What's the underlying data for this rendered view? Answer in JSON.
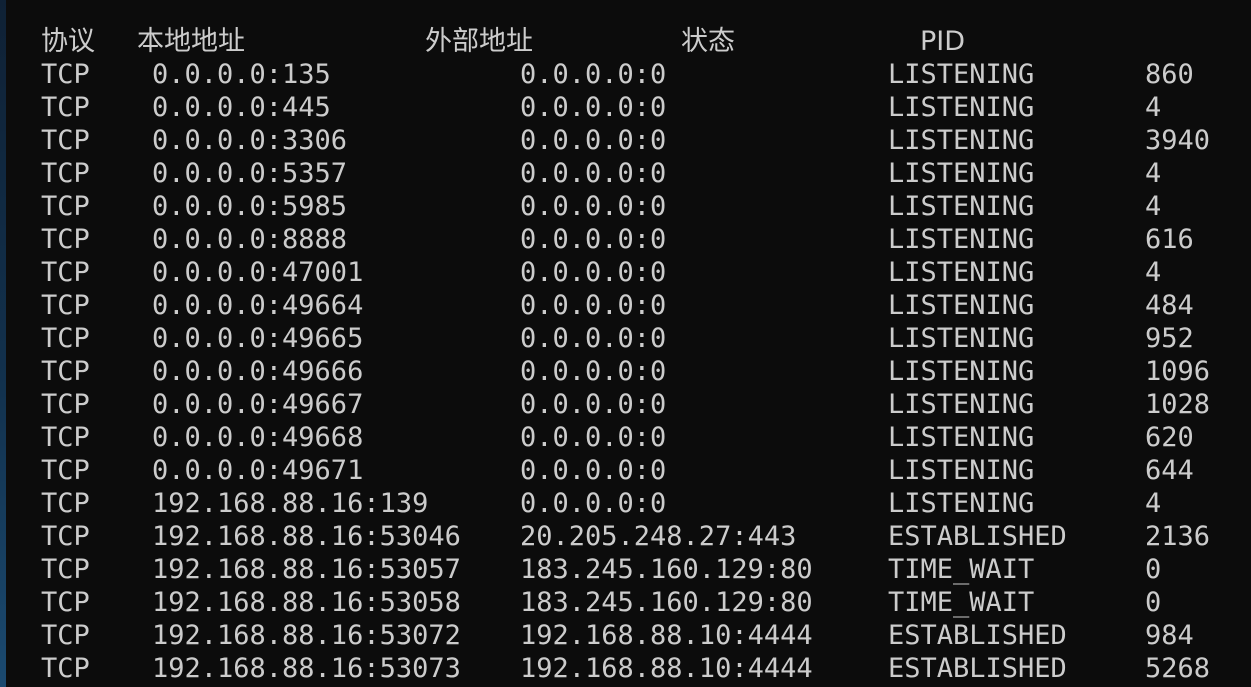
{
  "header": {
    "proto": "协议",
    "local": "本地地址",
    "foreign": "外部地址",
    "state": "状态",
    "pid": "PID"
  },
  "rows": [
    {
      "proto": "TCP",
      "local": "0.0.0.0:135",
      "foreign": "0.0.0.0:0",
      "state": "LISTENING",
      "pid": "860"
    },
    {
      "proto": "TCP",
      "local": "0.0.0.0:445",
      "foreign": "0.0.0.0:0",
      "state": "LISTENING",
      "pid": "4"
    },
    {
      "proto": "TCP",
      "local": "0.0.0.0:3306",
      "foreign": "0.0.0.0:0",
      "state": "LISTENING",
      "pid": "3940"
    },
    {
      "proto": "TCP",
      "local": "0.0.0.0:5357",
      "foreign": "0.0.0.0:0",
      "state": "LISTENING",
      "pid": "4"
    },
    {
      "proto": "TCP",
      "local": "0.0.0.0:5985",
      "foreign": "0.0.0.0:0",
      "state": "LISTENING",
      "pid": "4"
    },
    {
      "proto": "TCP",
      "local": "0.0.0.0:8888",
      "foreign": "0.0.0.0:0",
      "state": "LISTENING",
      "pid": "616"
    },
    {
      "proto": "TCP",
      "local": "0.0.0.0:47001",
      "foreign": "0.0.0.0:0",
      "state": "LISTENING",
      "pid": "4"
    },
    {
      "proto": "TCP",
      "local": "0.0.0.0:49664",
      "foreign": "0.0.0.0:0",
      "state": "LISTENING",
      "pid": "484"
    },
    {
      "proto": "TCP",
      "local": "0.0.0.0:49665",
      "foreign": "0.0.0.0:0",
      "state": "LISTENING",
      "pid": "952"
    },
    {
      "proto": "TCP",
      "local": "0.0.0.0:49666",
      "foreign": "0.0.0.0:0",
      "state": "LISTENING",
      "pid": "1096"
    },
    {
      "proto": "TCP",
      "local": "0.0.0.0:49667",
      "foreign": "0.0.0.0:0",
      "state": "LISTENING",
      "pid": "1028"
    },
    {
      "proto": "TCP",
      "local": "0.0.0.0:49668",
      "foreign": "0.0.0.0:0",
      "state": "LISTENING",
      "pid": "620"
    },
    {
      "proto": "TCP",
      "local": "0.0.0.0:49671",
      "foreign": "0.0.0.0:0",
      "state": "LISTENING",
      "pid": "644"
    },
    {
      "proto": "TCP",
      "local": "192.168.88.16:139",
      "foreign": "0.0.0.0:0",
      "state": "LISTENING",
      "pid": "4"
    },
    {
      "proto": "TCP",
      "local": "192.168.88.16:53046",
      "foreign": "20.205.248.27:443",
      "state": "ESTABLISHED",
      "pid": "2136"
    },
    {
      "proto": "TCP",
      "local": "192.168.88.16:53057",
      "foreign": "183.245.160.129:80",
      "state": "TIME_WAIT",
      "pid": "0"
    },
    {
      "proto": "TCP",
      "local": "192.168.88.16:53058",
      "foreign": "183.245.160.129:80",
      "state": "TIME_WAIT",
      "pid": "0"
    },
    {
      "proto": "TCP",
      "local": "192.168.88.16:53072",
      "foreign": "192.168.88.10:4444",
      "state": "ESTABLISHED",
      "pid": "984"
    },
    {
      "proto": "TCP",
      "local": "192.168.88.16:53073",
      "foreign": "192.168.88.10:4444",
      "state": "ESTABLISHED",
      "pid": "5268"
    }
  ]
}
